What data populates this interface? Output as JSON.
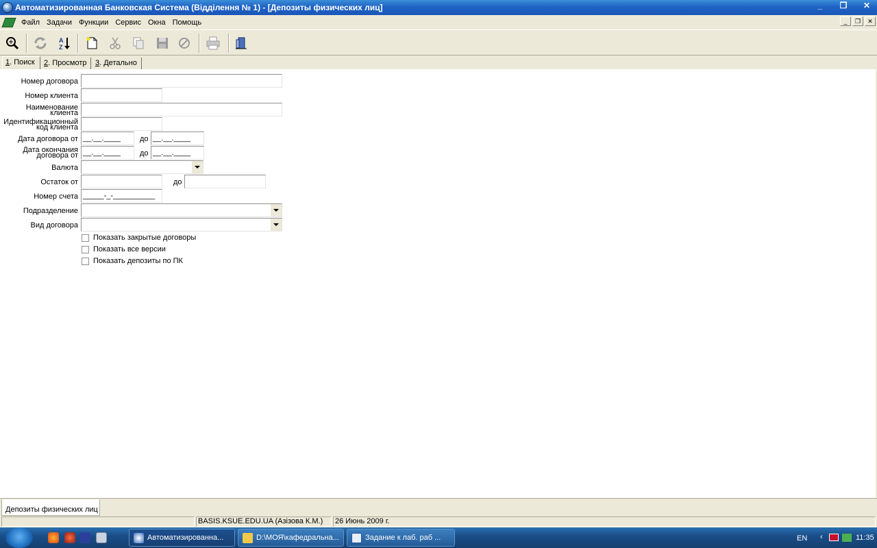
{
  "window": {
    "title": "Автоматизированная Банковская Система (Відділення № 1) - [Депозиты физических лиц]",
    "min_icon": "minimize-icon",
    "max_icon": "maximize-icon",
    "close_icon": "close-icon"
  },
  "menu": {
    "items": [
      "Файл",
      "Задачи",
      "Функции",
      "Сервис",
      "Окна",
      "Помощь"
    ]
  },
  "toolbar": {
    "icons": [
      "zoom-search-icon",
      "refresh-icon",
      "sort-az-icon",
      "new-document-icon",
      "cut-icon",
      "copy-icon",
      "save-icon",
      "cancel-icon",
      "print-icon",
      "exit-icon"
    ]
  },
  "tabs": [
    {
      "num": "1",
      "label": ". Поиск"
    },
    {
      "num": "2",
      "label": ". Просмотр"
    },
    {
      "num": "3",
      "label": ". Детально"
    }
  ],
  "form": {
    "contract_number": {
      "label": "Номер договора",
      "value": ""
    },
    "client_number": {
      "label": "Номер клиента",
      "value": ""
    },
    "client_name": {
      "label_1": "Наименование",
      "label_2": "клиента",
      "value": ""
    },
    "client_id_code": {
      "label_1": "Идентификационный",
      "label_2": "код клиента",
      "value": ""
    },
    "contract_date_from": {
      "label": "Дата договора от",
      "from_value": "__.__.____",
      "to_label": "до",
      "to_value": "__.__.____"
    },
    "end_date_from": {
      "label_1": "Дата окончания",
      "label_2": "договора от",
      "from_value": "__.__.____",
      "to_label": "до",
      "to_value": "__.__.____"
    },
    "currency": {
      "label": "Валюта",
      "value": ""
    },
    "balance_from": {
      "label": "Остаток от",
      "from_value": "",
      "to_label": "до",
      "to_value": ""
    },
    "account_number": {
      "label": "Номер счета",
      "value": "_____-_-__________"
    },
    "subdivision": {
      "label": "Подразделение",
      "value": ""
    },
    "contract_type": {
      "label": "Вид договора",
      "value": ""
    },
    "checkboxes": [
      {
        "label": "Показать закрытые договоры",
        "checked": false
      },
      {
        "label": "Показать все версии",
        "checked": false
      },
      {
        "label": "Показать депозиты по ПК",
        "checked": false
      }
    ]
  },
  "window_tab": {
    "label": "Депозиты физических лиц"
  },
  "statusbar": {
    "cell1": "",
    "server_user": "BASIS.KSUE.EDU.UA (Азізова К.М.)",
    "date": "26 Июнь 2009 г."
  },
  "taskbar": {
    "tasks": [
      {
        "label": "Автоматизированна..."
      },
      {
        "label": "D:\\МОЯ\\кафедральна..."
      },
      {
        "label": "Задание к лаб. раб ..."
      }
    ],
    "lang": "EN",
    "time": "11:35"
  }
}
